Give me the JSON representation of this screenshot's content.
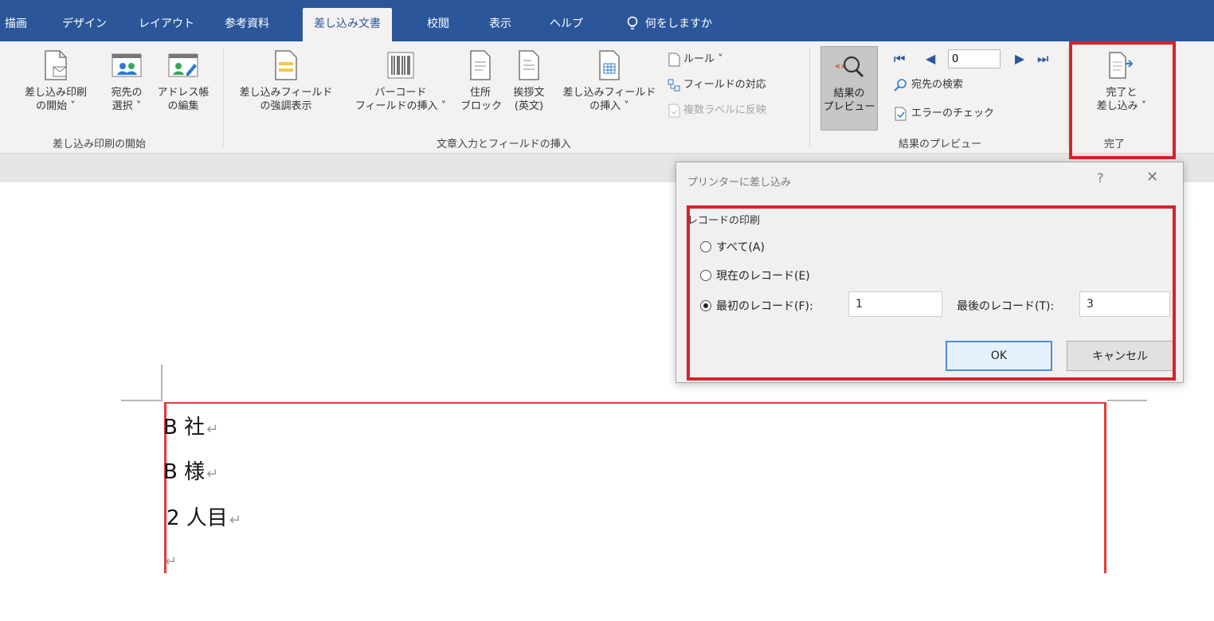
{
  "tabs": [
    {
      "label": "描画"
    },
    {
      "label": "デザイン"
    },
    {
      "label": "レイアウト"
    },
    {
      "label": "参考資料"
    },
    {
      "label": "差し込み文書",
      "active": true
    },
    {
      "label": "校閲"
    },
    {
      "label": "表示"
    },
    {
      "label": "ヘルプ"
    }
  ],
  "tell_me": "何をしますか",
  "groups": {
    "start": {
      "label": "差し込み印刷の開始",
      "buttons": [
        {
          "line1": "差し込み印刷",
          "line2": "の開始 ˅"
        },
        {
          "line1": "宛先の",
          "line2": "選択 ˅"
        },
        {
          "line1": "アドレス帳",
          "line2": "の編集"
        }
      ]
    },
    "insert": {
      "label": "文章入力とフィールドの挿入",
      "buttons": [
        {
          "line1": "差し込みフィールド",
          "line2": "の強調表示"
        },
        {
          "line1": "バーコード",
          "line2": "フィールドの挿入 ˅"
        },
        {
          "line1": "住所",
          "line2": "ブロック"
        },
        {
          "line1": "挨拶文",
          "line2": "(英文)"
        },
        {
          "line1": "差し込みフィールド",
          "line2": "の挿入 ˅"
        }
      ],
      "small": [
        {
          "label": "ルール ˅",
          "disabled": false
        },
        {
          "label": "フィールドの対応",
          "disabled": false
        },
        {
          "label": "複数ラベルに反映",
          "disabled": true
        }
      ]
    },
    "preview": {
      "label": "結果のプレビュー",
      "button": {
        "line1": "結果の",
        "line2": "プレビュー"
      },
      "record_value": "0",
      "small": [
        {
          "label": "宛先の検索"
        },
        {
          "label": "エラーのチェック"
        }
      ]
    },
    "finish": {
      "label": "完了",
      "button": {
        "line1": "完了と",
        "line2": "差し込み ˅"
      }
    }
  },
  "document": {
    "lines": [
      "B 社",
      "B 様",
      "2 人目",
      ""
    ],
    "para_mark": "↵"
  },
  "dialog": {
    "title": "プリンターに差し込み",
    "help": "?",
    "close": "✕",
    "group_title": "レコードの印刷",
    "options": [
      {
        "label": "すべて(A)",
        "selected": false
      },
      {
        "label": "現在のレコード(E)",
        "selected": false
      },
      {
        "label": "最初のレコード(F):",
        "selected": true
      }
    ],
    "first_record": "1",
    "last_label": "最後のレコード(T):",
    "last_record": "3",
    "ok": "OK",
    "cancel": "キャンセル"
  },
  "colors": {
    "ribbon_blue": "#2b579a",
    "highlight_red": "#d9222b"
  }
}
